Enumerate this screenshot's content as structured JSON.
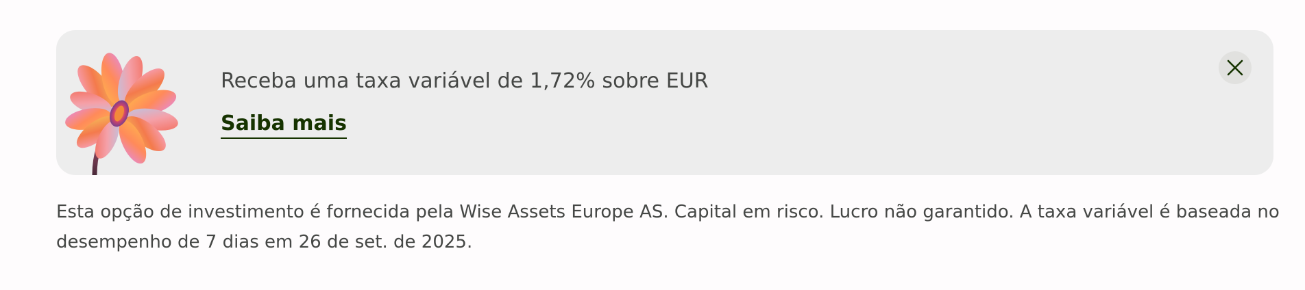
{
  "promo": {
    "headline": "Receba uma taxa variável de 1,72% sobre EUR",
    "link_label": "Saiba mais",
    "close_icon": "close-icon",
    "illustration_icon": "flower-illustration"
  },
  "disclaimer": {
    "text": "Esta opção de investimento é fornecida pela Wise Assets Europe AS. Capital em risco. Lucro não garantido. A taxa variável é baseada no desempenho de 7 dias em 26 de set. de 2025."
  },
  "colors": {
    "card_background": "#ededed",
    "link_color": "#163300",
    "text_color": "#454745",
    "close_button_bg": "#e1e1df"
  }
}
